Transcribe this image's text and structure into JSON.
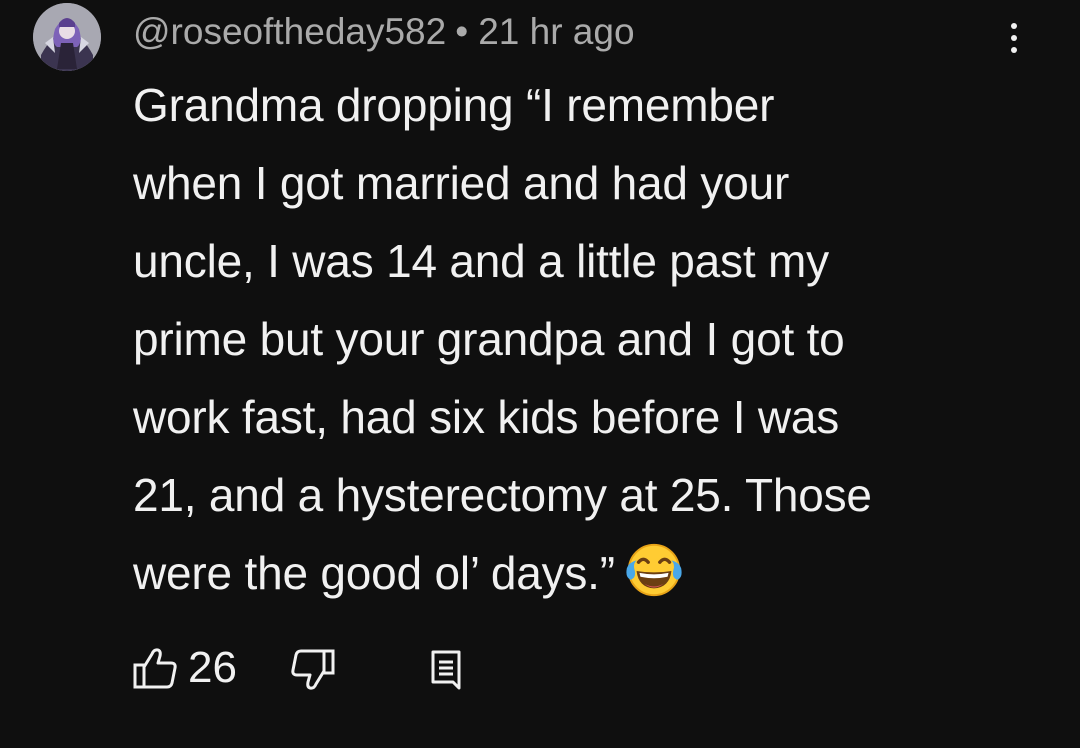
{
  "comment": {
    "author": "@roseoftheday582",
    "separator": "•",
    "timestamp": "21 hr ago",
    "text_lines": [
      "Grandma dropping “I remember",
      "when I got married and had your",
      "uncle, I was 14 and a little past my",
      "prime but your grandpa and I got to",
      "work fast, had six kids before I was",
      "21, and a hysterectomy at 25. Those",
      "were the good ol’ days.”"
    ],
    "emoji": "face-with-tears-of-joy",
    "like_count": "26"
  },
  "icons": {
    "avatar": "avatar",
    "more": "more-vert-icon",
    "like": "thumbs-up-icon",
    "dislike": "thumbs-down-icon",
    "reply": "reply-comment-icon"
  },
  "colors": {
    "background": "#0f0f0f",
    "primary_text": "#f1f1f1",
    "secondary_text": "#aaaaaa"
  }
}
